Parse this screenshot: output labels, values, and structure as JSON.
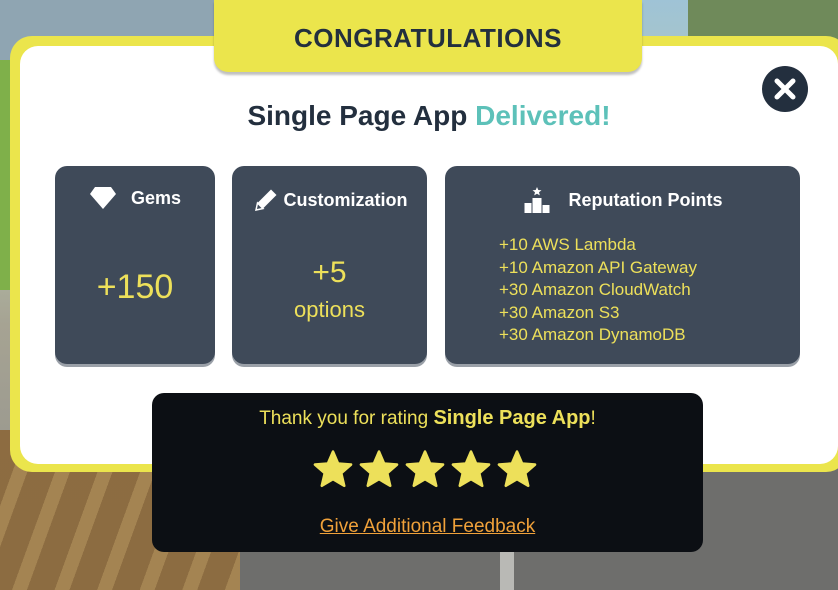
{
  "modal": {
    "title": "CONGRATULATIONS",
    "headline_main": "Single Page App",
    "headline_accent": "Delivered!"
  },
  "cards": {
    "gems": {
      "icon": "gem-icon",
      "label": "Gems",
      "value": "+150"
    },
    "customization": {
      "icon": "pencil-icon",
      "label": "Customization",
      "value": "+5",
      "unit": "options"
    },
    "reputation": {
      "icon": "podium-icon",
      "label": "Reputation Points",
      "items": [
        "+10 AWS Lambda",
        "+10 Amazon API Gateway",
        "+30 Amazon CloudWatch",
        "+30 Amazon S3",
        "+30 Amazon DynamoDB"
      ]
    }
  },
  "rating": {
    "thanks_prefix": "Thank you for rating ",
    "app_name": "Single Page App",
    "thanks_suffix": "!",
    "stars_filled": 5,
    "stars_total": 5,
    "feedback_link": "Give Additional Feedback"
  },
  "colors": {
    "modal_yellow": "#ebe54c",
    "card_bg": "#3f4a59",
    "accent_teal": "#5dc1b9",
    "value_yellow": "#ede05a",
    "link_orange": "#f0a13a",
    "dark_navy": "#232f3e"
  }
}
